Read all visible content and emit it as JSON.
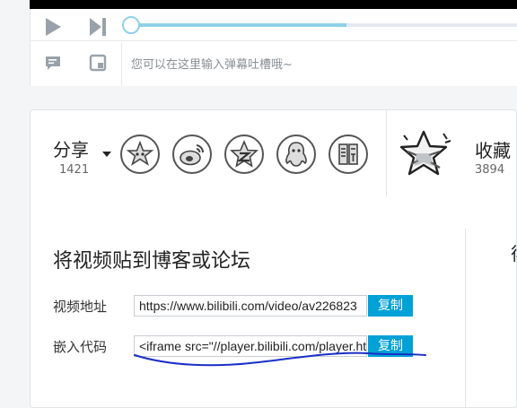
{
  "player": {
    "progress_fraction": 0.56,
    "danmaku_placeholder": "您可以在这里输入弹幕吐槽哦~"
  },
  "share": {
    "label": "分享",
    "count": "1421",
    "icons": [
      "dynamic-share-icon",
      "weibo-icon",
      "qzone-icon",
      "qq-icon",
      "tieba-icon"
    ]
  },
  "favorite": {
    "label": "收藏",
    "count": "3894"
  },
  "embed": {
    "title": "将视频贴到博客或论坛",
    "video_url_label": "视频地址",
    "video_url_value": "https://www.bilibili.com/video/av226823",
    "embed_code_label": "嵌入代码",
    "embed_code_value": "<iframe src=\"//player.bilibili.com/player.html",
    "copy_label": "复制"
  },
  "right_partial_char": "徘",
  "colors": {
    "accent": "#00a1d6",
    "progress": "#8fd0e8",
    "scribble": "#1a2fc7"
  }
}
